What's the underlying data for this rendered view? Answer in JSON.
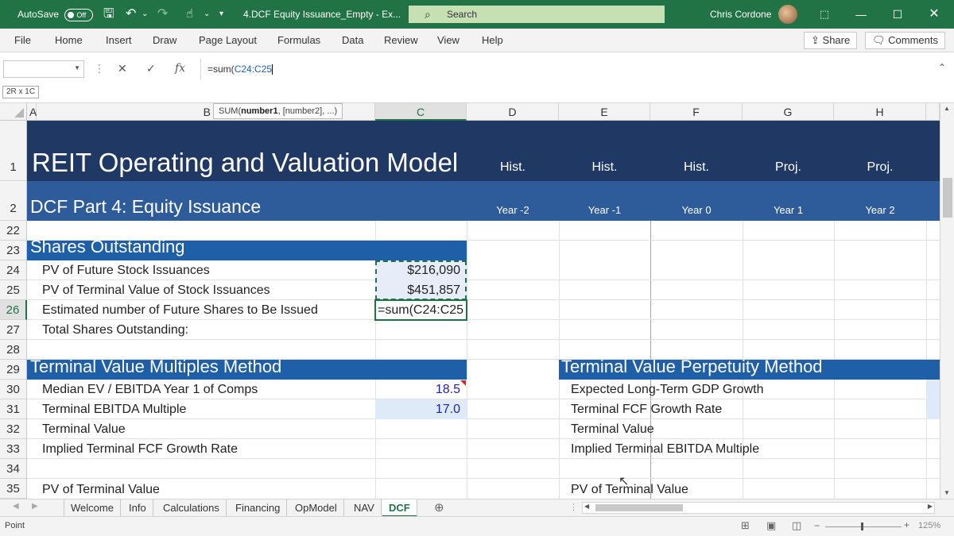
{
  "titlebar": {
    "autosave_label": "AutoSave",
    "autosave_state": "Off",
    "doc_title": "4.DCF Equity Issuance_Empty - Ex...",
    "search_placeholder": "Search",
    "user_name": "Chris Cordone"
  },
  "ribbon": {
    "tabs": [
      "File",
      "Home",
      "Insert",
      "Draw",
      "Page Layout",
      "Formulas",
      "Data",
      "Review",
      "View",
      "Help"
    ],
    "share_label": "Share",
    "comments_label": "Comments"
  },
  "formula_bar": {
    "name_box": "",
    "fx_label": "fx",
    "formula_prefix": "=sum(",
    "formula_ref": "C24:C25",
    "selection_size": "2R x 1C"
  },
  "tooltip": {
    "func": "SUM(",
    "arg1": "number1",
    "rest": ", [number2], ...)"
  },
  "columns": [
    "A",
    "B",
    "C",
    "D",
    "E",
    "F",
    "G",
    "H"
  ],
  "rows": [
    "1",
    "2",
    "22",
    "23",
    "24",
    "25",
    "26",
    "27",
    "28",
    "29",
    "30",
    "31",
    "32",
    "33",
    "34",
    "35"
  ],
  "sheet": {
    "title": "REIT Operating and Valuation Model",
    "subtitle": "DCF Part 4: Equity Issuance",
    "periods": [
      {
        "type": "Hist.",
        "year": "Year -2"
      },
      {
        "type": "Hist.",
        "year": "Year -1"
      },
      {
        "type": "Hist.",
        "year": "Year 0"
      },
      {
        "type": "Proj.",
        "year": "Year 1"
      },
      {
        "type": "Proj.",
        "year": "Year 2"
      }
    ],
    "shares_header": "Shares Outstanding",
    "pv_future_label": "PV of Future Stock Issuances",
    "pv_future_value": "$216,090",
    "pv_terminal_label": "PV of Terminal Value of Stock Issuances",
    "pv_terminal_value": "$451,857",
    "est_shares_label": "Estimated number of Future Shares to Be Issued",
    "est_shares_formula": "=sum(C24:C25",
    "total_shares_label": "Total Shares Outstanding:",
    "multiples_header": "Terminal Value Multiples Method",
    "median_ev_label": "Median EV / EBITDA Year 1 of Comps",
    "median_ev_value": "18.5",
    "terminal_ebitda_label": "Terminal EBITDA  Multiple",
    "terminal_ebitda_value": "17.0",
    "terminal_value_label": "Terminal Value",
    "implied_fcf_label": "Implied Terminal FCF Growth Rate",
    "pv_tv_label": "PV of Terminal Value",
    "perpetuity_header": "Terminal Value Perpetuity Method",
    "gdp_growth_label": "Expected Long-Term GDP Growth",
    "fcf_growth_label": "Terminal FCF Growth Rate",
    "terminal_value_label2": "Terminal Value",
    "implied_ebitda_label": "Implied Terminal EBITDA Multiple",
    "pv_tv_label2": "PV of Terminal Value"
  },
  "sheet_tabs": [
    "Welcome",
    "Info",
    "Calculations",
    "Financing",
    "OpModel",
    "NAV",
    "DCF"
  ],
  "active_tab": "DCF",
  "status": {
    "mode": "Point",
    "zoom": "125%"
  },
  "colors": {
    "excel_green": "#217346",
    "title_navy": "#1f3864",
    "header_blue": "#2e5c9a",
    "input_blue": "#1f1fbf"
  }
}
